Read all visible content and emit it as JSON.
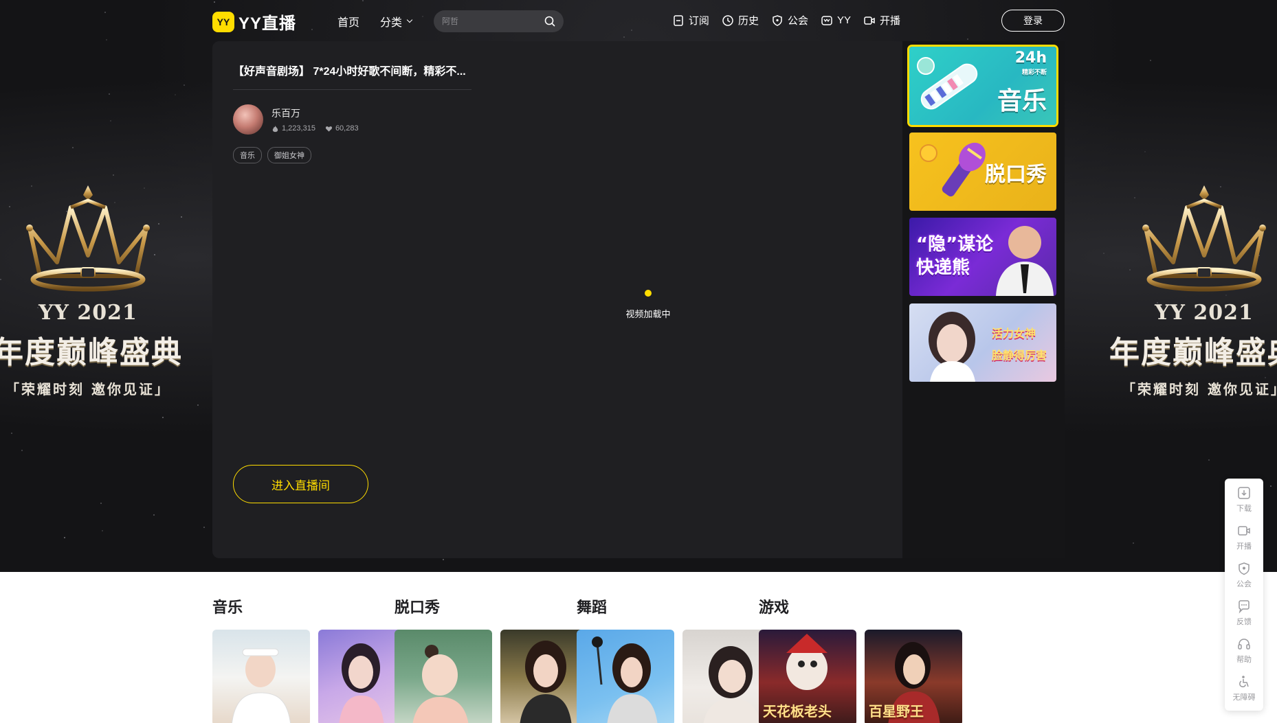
{
  "brand": {
    "badge": "YY",
    "name": "YY直播"
  },
  "nav": {
    "home": "首页",
    "category": "分类",
    "search_placeholder": "阿哲",
    "right": [
      {
        "label": "订阅",
        "icon": "subscribe-icon"
      },
      {
        "label": "历史",
        "icon": "clock-icon"
      },
      {
        "label": "公会",
        "icon": "shield-icon"
      },
      {
        "label": "YY",
        "icon": "yy-icon"
      },
      {
        "label": "开播",
        "icon": "camera-icon"
      }
    ],
    "login": "登录"
  },
  "decoration": {
    "year": "YY 2021",
    "title": "年度巅峰盛典",
    "subtitle": "「荣耀时刻 邀你见证」"
  },
  "player": {
    "title": "【好声音剧场】 7*24小时好歌不间断，精彩不...",
    "anchor_name": "乐百万",
    "heat": "1,223,315",
    "likes": "60,283",
    "tags": [
      "音乐",
      "御姐女神"
    ],
    "loading_text": "视频加载中",
    "enter_button": "进入直播间"
  },
  "channels": [
    {
      "label": "音乐",
      "badge": "24h",
      "badge_sub": "精彩不断",
      "active": true
    },
    {
      "label": "脱口秀",
      "active": false
    },
    {
      "label": "“隐”谋论 快递熊",
      "active": false
    },
    {
      "label": "活力女神 脸静得厉害",
      "active": false
    }
  ],
  "sidebar": [
    {
      "label": "下载",
      "icon": "download-icon"
    },
    {
      "label": "开播",
      "icon": "camera-icon"
    },
    {
      "label": "公会",
      "icon": "shield-icon"
    },
    {
      "label": "反馈",
      "icon": "feedback-icon"
    },
    {
      "label": "帮助",
      "icon": "headset-icon"
    },
    {
      "label": "无障碍",
      "icon": "accessibility-icon"
    }
  ],
  "categories": [
    {
      "title": "音乐",
      "thumbs": [
        "",
        ""
      ]
    },
    {
      "title": "脱口秀",
      "thumbs": [
        "",
        ""
      ]
    },
    {
      "title": "舞蹈",
      "thumbs": [
        "",
        ""
      ]
    },
    {
      "title": "游戏",
      "thumbs": [
        "天花板老头",
        "百星野王"
      ]
    }
  ],
  "colors": {
    "accent": "#ffdd00",
    "panel": "#1f1f22",
    "background": "#141416"
  }
}
